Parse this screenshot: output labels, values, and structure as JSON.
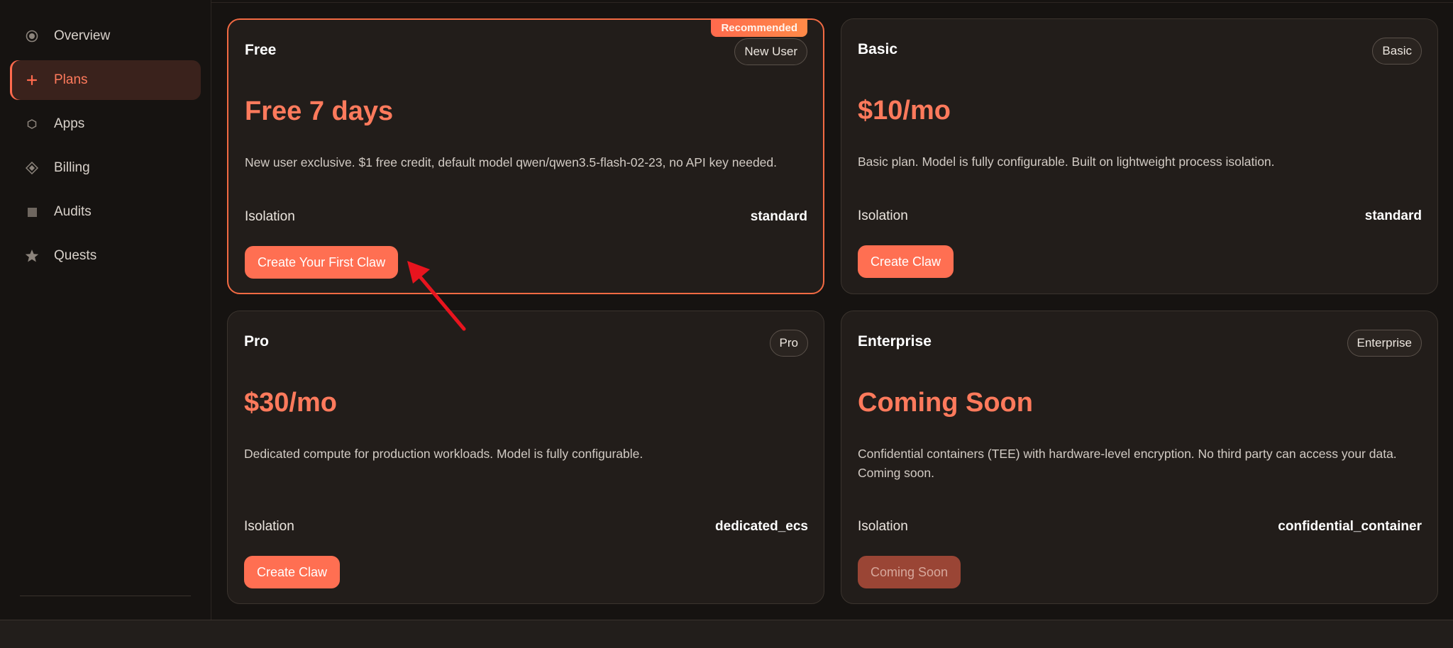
{
  "sidebar": {
    "items": [
      {
        "label": "Overview",
        "icon": "radio-dot-icon"
      },
      {
        "label": "Plans",
        "icon": "plus-icon",
        "active": true
      },
      {
        "label": "Apps",
        "icon": "hexagon-icon"
      },
      {
        "label": "Billing",
        "icon": "diamond-icon"
      },
      {
        "label": "Audits",
        "icon": "square-icon"
      },
      {
        "label": "Quests",
        "icon": "star-icon"
      }
    ]
  },
  "plans": {
    "free": {
      "title": "Free",
      "ribbon": "Recommended",
      "tag": "New User",
      "price": "Free 7 days",
      "description": "New user exclusive. $1 free credit, default model qwen/qwen3.5-flash-02-23, no API key needed.",
      "isolation_label": "Isolation",
      "isolation_value": "standard",
      "button": "Create Your First Claw"
    },
    "basic": {
      "title": "Basic",
      "tag": "Basic",
      "price": "$10/mo",
      "description": "Basic plan. Model is fully configurable. Built on lightweight process isolation.",
      "isolation_label": "Isolation",
      "isolation_value": "standard",
      "button": "Create Claw"
    },
    "pro": {
      "title": "Pro",
      "tag": "Pro",
      "price": "$30/mo",
      "description": "Dedicated compute for production workloads. Model is fully configurable.",
      "isolation_label": "Isolation",
      "isolation_value": "dedicated_ecs",
      "button": "Create Claw"
    },
    "enterprise": {
      "title": "Enterprise",
      "tag": "Enterprise",
      "price": "Coming Soon",
      "description": "Confidential containers (TEE) with hardware-level encryption. No third party can access your data. Coming soon.",
      "isolation_label": "Isolation",
      "isolation_value": "confidential_container",
      "button": "Coming Soon"
    }
  },
  "colors": {
    "accent": "#ff6f52",
    "price": "#ff7a5c",
    "background": "#161311",
    "card": "#221d1a",
    "annotation_arrow": "#e8141e"
  }
}
